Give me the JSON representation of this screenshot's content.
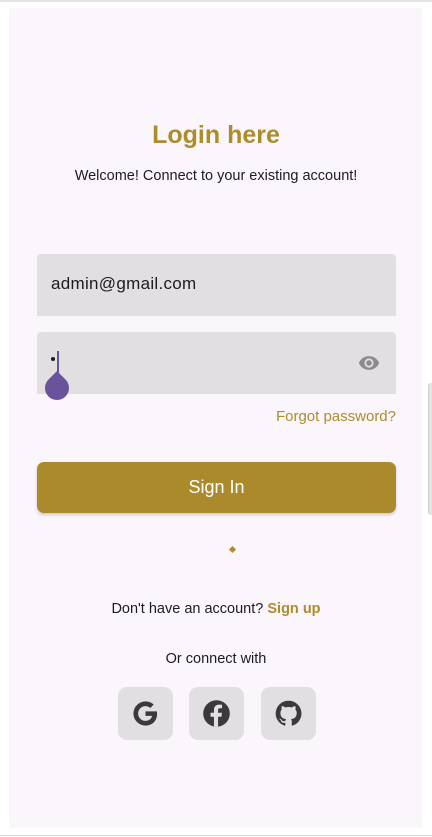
{
  "header": {
    "title": "Login here",
    "subtitle": "Welcome! Connect to your existing account!"
  },
  "form": {
    "email_value": "admin@gmail.com",
    "password_masked": "•",
    "forgot_label": "Forgot password?",
    "submit_label": "Sign In"
  },
  "signup": {
    "prompt": "Don't have an account?",
    "link_label": "Sign up"
  },
  "social": {
    "label": "Or connect with",
    "providers": [
      "google-icon",
      "facebook-icon",
      "github-icon"
    ]
  },
  "colors": {
    "accent": "#ad8c2a",
    "button": "#ab8a2b",
    "field_bg": "#e2dfe3",
    "background": "#fbf6fb",
    "cursor": "#6a539c"
  }
}
